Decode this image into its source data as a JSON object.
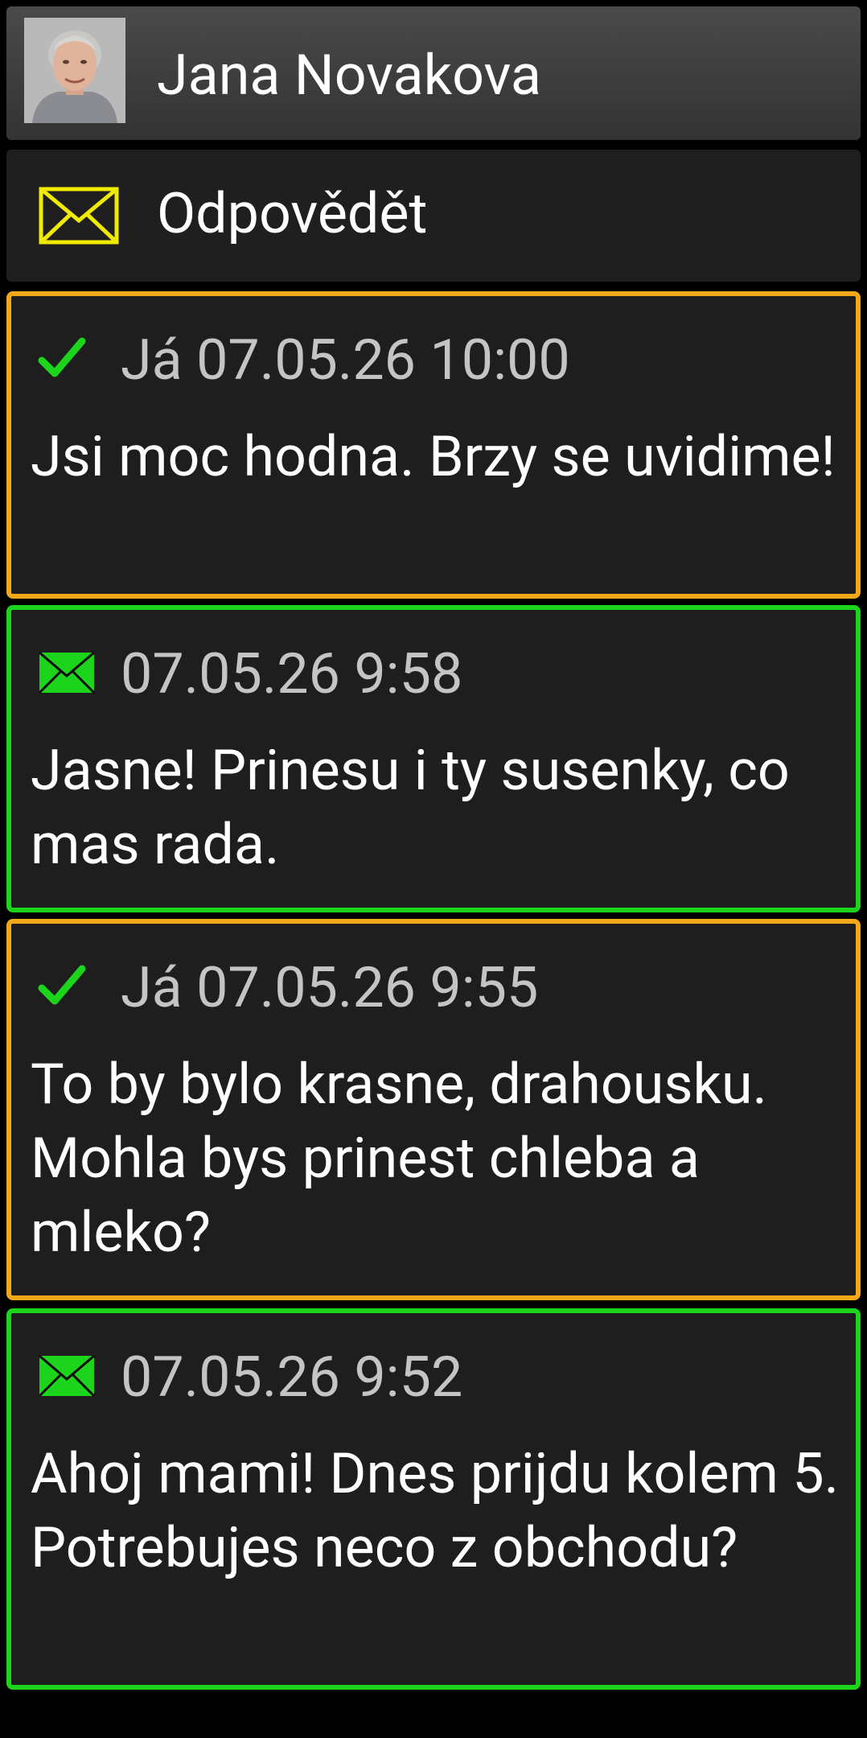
{
  "contact": {
    "name": "Jana Novakova"
  },
  "reply": {
    "label": "Odpovědět"
  },
  "colors": {
    "sent_border": "#f1a81a",
    "received_border": "#1bd41b",
    "reply_icon": "#f0ea00",
    "sent_check": "#1bd41b"
  },
  "messages": [
    {
      "direction": "sent",
      "icon": "check-icon",
      "meta": "Já 07.05.26 10:00",
      "text": "Jsi moc hodna. Brzy se uvidime!"
    },
    {
      "direction": "received",
      "icon": "envelope-icon",
      "meta": "07.05.26 9:58",
      "text": "Jasne! Prinesu i ty susenky, co mas rada."
    },
    {
      "direction": "sent",
      "icon": "check-icon",
      "meta": "Já 07.05.26 9:55",
      "text": "To by bylo krasne, drahousku. Mohla bys prinest chleba a mleko?"
    },
    {
      "direction": "received",
      "icon": "envelope-icon",
      "meta": "07.05.26 9:52",
      "text": "Ahoj mami! Dnes prijdu kolem 5. Potrebujes neco z obchodu?"
    }
  ]
}
